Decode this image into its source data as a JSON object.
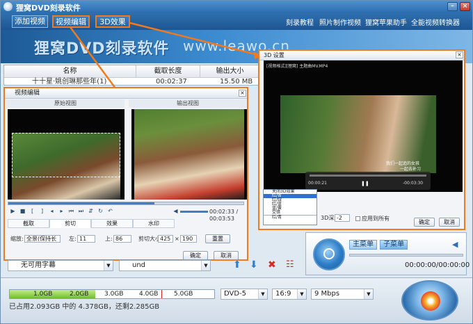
{
  "window": {
    "title": "狸窝DVD刻录软件",
    "min": "–",
    "close": "×"
  },
  "menubar": {
    "tabs": [
      "添加视频",
      "视频编辑",
      "3D效果"
    ],
    "links": [
      "刻录教程",
      "照片制作视频",
      "狸窝苹果助手",
      "全能视频转换器"
    ]
  },
  "banner": {
    "text": "狸窝DVD刻录软件",
    "url": "www.leawo.cn"
  },
  "filelist": {
    "headers": [
      "名称",
      "截取长度",
      "输出大小"
    ],
    "row": {
      "name": "十十星·姚创琳那些年(1)",
      "length": "00:02:37",
      "size": "15.50 MB"
    }
  },
  "edit_dialog": {
    "title": "视频编辑",
    "original_label": "原始视图",
    "output_label": "输出视图",
    "time": "00:02:33 / 00:03:53",
    "tabs": [
      "截取",
      "剪切",
      "效果",
      "水印"
    ],
    "zoom_label": "缩放:",
    "zoom_value": "全景(保持长",
    "left_label": "左:",
    "left_value": "11",
    "top_label": "上:",
    "top_value": "86",
    "size_label": "剪切大小:",
    "width_value": "425",
    "height_value": "190",
    "times": "×",
    "reset": "重置",
    "ok": "确定",
    "cancel": "取消"
  },
  "d3_dialog": {
    "title": "3D 设置",
    "file_label": "[视频格式][狸窝] 主题曲MV.MP4",
    "caption_main": "我们一起追的女孩",
    "caption_sub": "一起去补习",
    "time_left": "00:00:21",
    "time_right": "-00:03:30",
    "dropdown_items": [
      "关闭3D效果",
      "红/青",
      "红/绿",
      "红/蓝",
      "蓝/黄",
      "交错",
      "红/青"
    ],
    "depth_label": "3D深度",
    "depth_value": "-2",
    "apply_all": "应用到所有",
    "ok": "确定",
    "cancel": "取消"
  },
  "player": {
    "main_menu": "主菜单",
    "sub_menu": "子菜单",
    "time": "00:00:00/00:00:00"
  },
  "subtitle": {
    "value": "无可用字幕",
    "audio": "und"
  },
  "bottom": {
    "capacity_labels": [
      "1.0GB",
      "2.0GB",
      "3.0GB",
      "4.0GB",
      "5.0GB"
    ],
    "used_fraction": 0.42,
    "disc": "DVD-5",
    "aspect": "16:9",
    "bitrate": "9 Mbps",
    "status": "已占用2.093GB 中的 4.378GB，还剩2.285GB"
  },
  "colors": {
    "accent": "#f07a1e",
    "titlebar": "#2a6db0"
  }
}
